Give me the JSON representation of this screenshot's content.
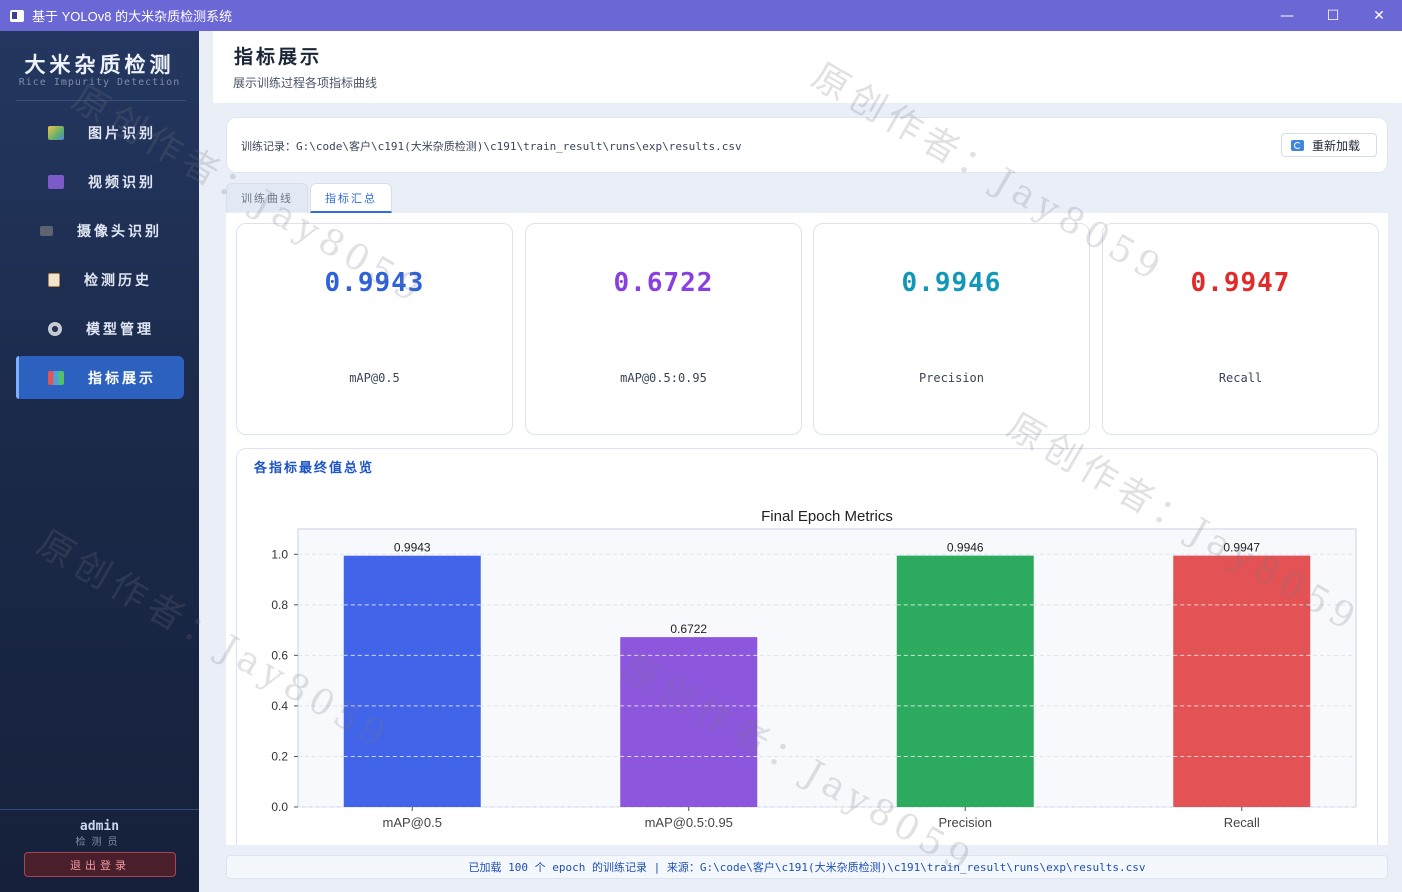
{
  "window": {
    "title": "基于 YOLOv8 的大米杂质检测系统",
    "minimize": "—",
    "maximize": "☐",
    "close": "✕"
  },
  "sidebar": {
    "brand_title": "大米杂质检测",
    "brand_subtitle": "Rice Impurity Detection",
    "items": [
      {
        "label": "图片识别",
        "icon": "image-icon"
      },
      {
        "label": "视频识别",
        "icon": "video-icon"
      },
      {
        "label": "摄像头识别",
        "icon": "camera-icon"
      },
      {
        "label": "检测历史",
        "icon": "history-icon"
      },
      {
        "label": "模型管理",
        "icon": "gear-icon"
      },
      {
        "label": "指标展示",
        "icon": "chart-icon",
        "active": true
      }
    ],
    "user": {
      "name": "admin",
      "role": "检测员",
      "logout_label": "退出登录"
    }
  },
  "header": {
    "title": "指标展示",
    "subtitle": "展示训练过程各项指标曲线"
  },
  "record": {
    "label": "训练记录：G:\\code\\客户\\c191(大米杂质检测)\\c191\\train_result\\runs\\exp\\results.csv",
    "reload_label": "重新加载"
  },
  "tabs": [
    {
      "label": "训练曲线",
      "active": false
    },
    {
      "label": "指标汇总",
      "active": true
    }
  ],
  "cards": [
    {
      "value": "0.9943",
      "label": "mAP@0.5",
      "color": "#2f62d9"
    },
    {
      "value": "0.6722",
      "label": "mAP@0.5:0.95",
      "color": "#8a3fe0"
    },
    {
      "value": "0.9946",
      "label": "Precision",
      "color": "#1198b8"
    },
    {
      "value": "0.9947",
      "label": "Recall",
      "color": "#e02b2b"
    }
  ],
  "summary": {
    "title": "各指标最终值总览"
  },
  "chart_data": {
    "type": "bar",
    "title": "Final Epoch Metrics",
    "categories": [
      "mAP@0.5",
      "mAP@0.5:0.95",
      "Precision",
      "Recall"
    ],
    "values": [
      0.9943,
      0.6722,
      0.9946,
      0.9947
    ],
    "value_labels": [
      "0.9943",
      "0.6722",
      "0.9946",
      "0.9947"
    ],
    "colors": [
      "#4264e8",
      "#8c56dd",
      "#2caa5e",
      "#e35254"
    ],
    "ylim": [
      0,
      1.1
    ],
    "yticks": [
      0.0,
      0.2,
      0.4,
      0.6,
      0.8,
      1.0
    ],
    "ytick_labels": [
      "0.0",
      "0.2",
      "0.4",
      "0.6",
      "0.8",
      "1.0"
    ],
    "xlabel": "",
    "ylabel": "",
    "grid": true
  },
  "status": {
    "text": "已加载 100 个 epoch 的训练记录  |  来源：G:\\code\\客户\\c191(大米杂质检测)\\c191\\train_result\\runs\\exp\\results.csv"
  },
  "watermark": {
    "text": "原创作者：Jay8059"
  }
}
